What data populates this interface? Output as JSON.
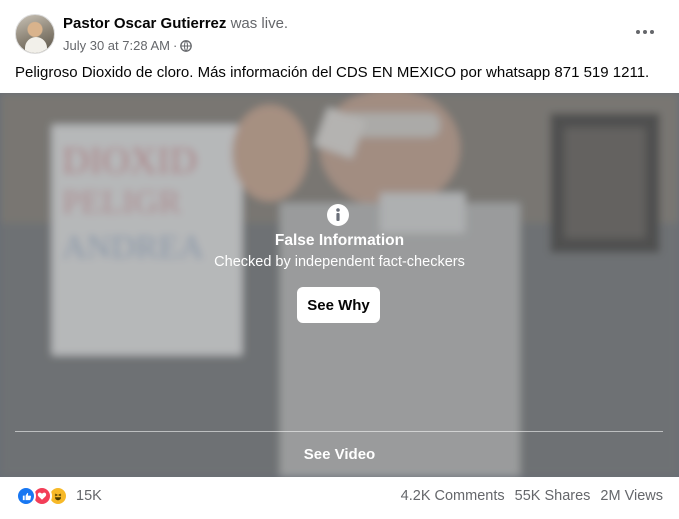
{
  "post": {
    "author": "Pastor Oscar Gutierrez",
    "status": "was live.",
    "timestamp": "July 30 at 7:28 AM",
    "separator": "·",
    "text": "Peligroso Dioxido de cloro. Más información del CDS EN MEXICO por whatsapp 871 519 1211."
  },
  "video": {
    "whiteboard_lines": [
      "DIOXID",
      "PELIGR",
      "ANDREA",
      "..."
    ],
    "warning_title": "False Information",
    "warning_subtitle": "Checked by independent fact-checkers",
    "see_why_label": "See Why",
    "see_video_label": "See Video"
  },
  "stats": {
    "reaction_icons": [
      "like-icon",
      "love-icon",
      "haha-icon"
    ],
    "reaction_count": "15K",
    "comments": "4.2K Comments",
    "shares": "55K Shares",
    "views": "2M Views"
  },
  "colors": {
    "like": "#1877f2",
    "love": "#f33e58",
    "haha": "#f7b928",
    "secondary_text": "#65676b"
  }
}
